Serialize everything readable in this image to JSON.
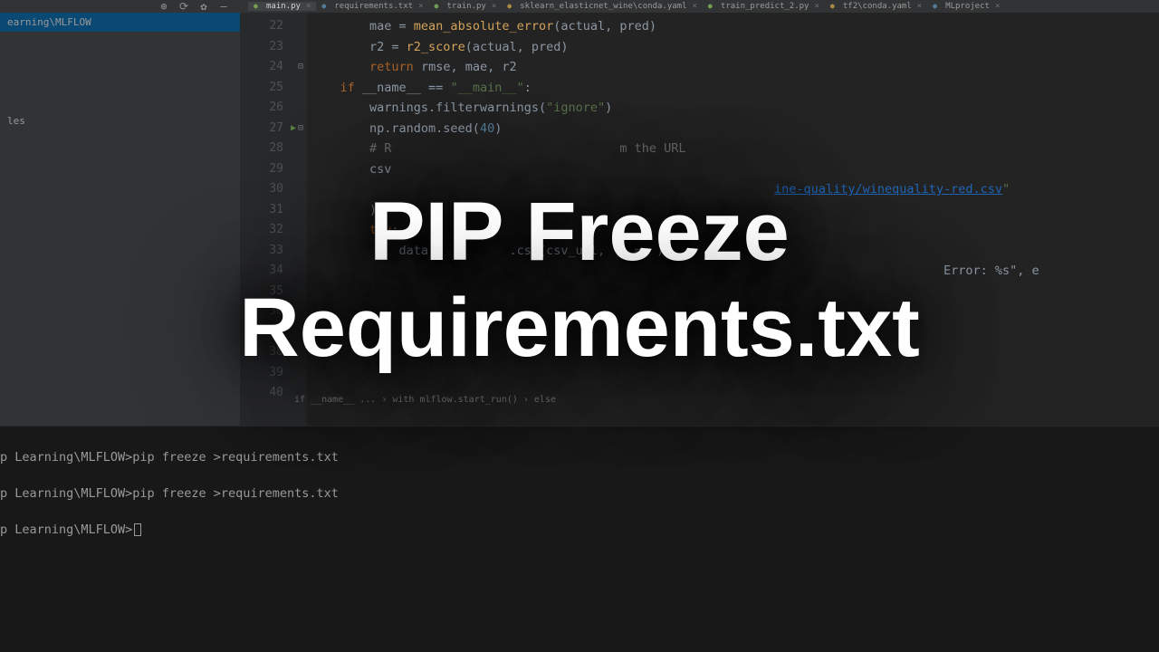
{
  "tabs": [
    {
      "label": "main.py",
      "type": "py",
      "active": true
    },
    {
      "label": "requirements.txt",
      "type": "txt"
    },
    {
      "label": "train.py",
      "type": "py"
    },
    {
      "label": "sklearn_elasticnet_wine\\conda.yaml",
      "type": "yaml"
    },
    {
      "label": "train_predict_2.py",
      "type": "py"
    },
    {
      "label": "tf2\\conda.yaml",
      "type": "yaml"
    },
    {
      "label": "MLproject",
      "type": "txt"
    }
  ],
  "sidebar": {
    "path": "earning\\MLFLOW",
    "sub": "les"
  },
  "gutter": {
    "start": 22,
    "end": 40,
    "marked": [
      27
    ]
  },
  "code": {
    "lines": [
      {
        "n": 22,
        "html": "        mae = <span class='k-yellow'>mean_absolute_error</span>(actual, pred)"
      },
      {
        "n": 23,
        "html": "        r2 = <span class='k-yellow'>r2_score</span>(actual, pred)"
      },
      {
        "n": 24,
        "html": "        <span class='k-orange'>return</span> rmse, mae, r2"
      },
      {
        "n": 25,
        "html": ""
      },
      {
        "n": 26,
        "html": ""
      },
      {
        "n": 27,
        "html": "    <span class='k-orange'>if</span> __name__ == <span class='k-green'>\"__main__\"</span>:"
      },
      {
        "n": 28,
        "html": "        warnings.filterwarnings(<span class='k-green'>\"ignore\"</span>)"
      },
      {
        "n": 29,
        "html": "        np.random.seed(<span class='k-blue'>40</span>)"
      },
      {
        "n": 30,
        "html": ""
      },
      {
        "n": 31,
        "html": "        <span class='k-gray'># R                               m the URL</span>"
      },
      {
        "n": 32,
        "html": "        csv"
      },
      {
        "n": 33,
        "html": "                                                               <span class='k-underline'>ine-quality/winequality-red.csv</span><span class='k-green'>\"</span>"
      },
      {
        "n": 34,
        "html": "        )"
      },
      {
        "n": 35,
        "html": "        <span class='k-orange'>try</span>:"
      },
      {
        "n": 36,
        "html": "            data =         .csv(csv_url,    =  )"
      },
      {
        "n": 37,
        "html": ""
      },
      {
        "n": 38,
        "html": "                                                                                      Error: %s\", e"
      },
      {
        "n": 39,
        "html": ""
      },
      {
        "n": 40,
        "html": ""
      }
    ]
  },
  "breadcrumb": "if __name__ ...    ›    with mlflow.start_run()    ›    else",
  "terminal": {
    "prompt_path": "p Learning\\MLFLOW>",
    "lines": [
      "p Learning\\MLFLOW>pip freeze >requirements.txt",
      "p Learning\\MLFLOW>pip freeze >requirements.txt",
      "p Learning\\MLFLOW>"
    ]
  },
  "overlay": {
    "line1": "PIP Freeze",
    "line2": "Requirements.txt"
  }
}
